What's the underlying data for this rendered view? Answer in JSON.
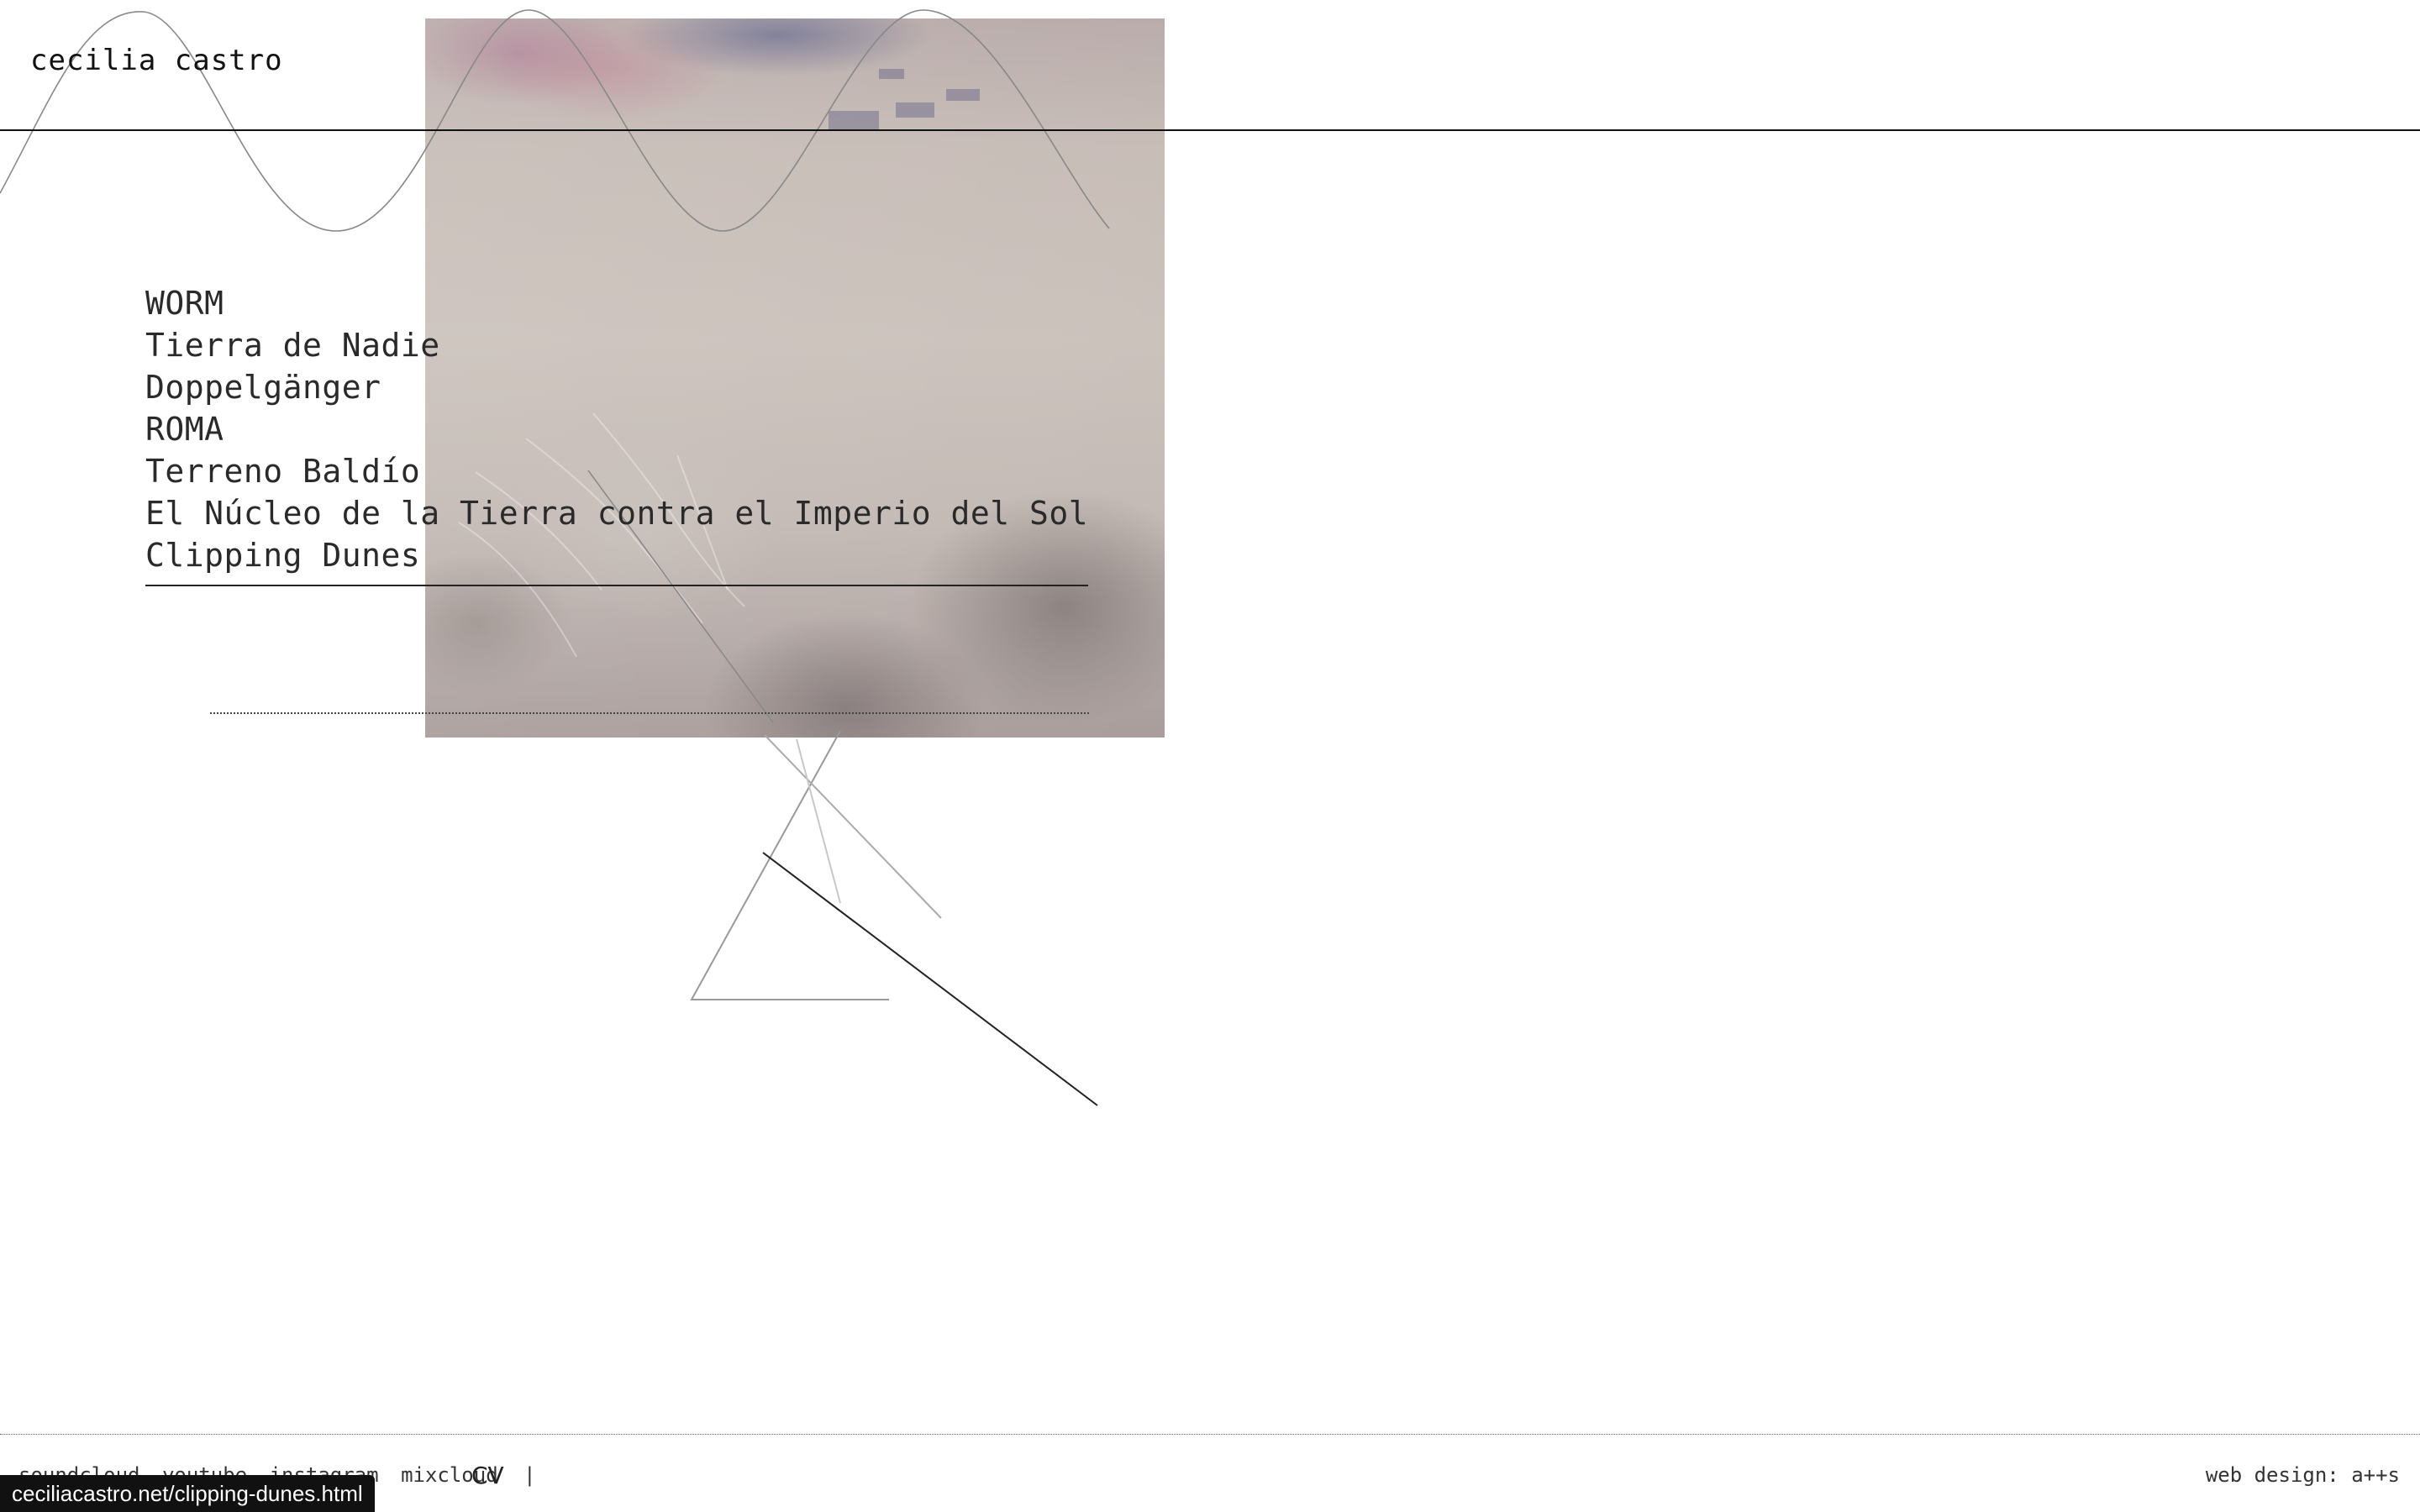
{
  "site": {
    "title": "cecilia castro"
  },
  "projects": [
    {
      "label": "WORM"
    },
    {
      "label": "Tierra de Nadie"
    },
    {
      "label": "Doppelgänger"
    },
    {
      "label": "ROMA"
    },
    {
      "label": "Terreno Baldío"
    },
    {
      "label": "El Núcleo de la Tierra contra el Imperio del Sol"
    },
    {
      "label": "Clipping Dunes"
    }
  ],
  "hero_image": {
    "description_icon": "desert-aerial-image"
  },
  "footer": {
    "links": [
      "soundcloud",
      "youtube",
      "instagram",
      "mixcloud"
    ],
    "separator": "|",
    "cv": "CV",
    "credit": "web design: a++s"
  },
  "status_bar": {
    "url": "ceciliacastro.net/clipping-dunes.html"
  }
}
